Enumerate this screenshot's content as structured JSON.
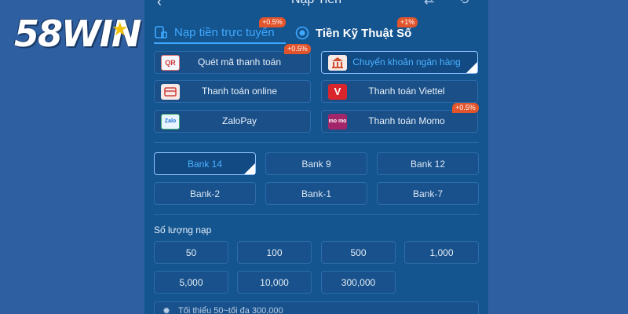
{
  "brand": {
    "logo_text": "58WIN"
  },
  "header": {
    "title": "Nạp Tiền",
    "back_glyph": "‹",
    "icon1": "transfer-icon",
    "icon2": "history-icon"
  },
  "tabs": [
    {
      "label": "Nạp tiền trực tuyến",
      "badge": "+0.5%",
      "active": true
    },
    {
      "label": "Tiền Kỹ Thuật Số",
      "badge": "+1%",
      "active": false
    }
  ],
  "methods": [
    {
      "label": "Quét mã thanh toán",
      "badge": "+0.5%",
      "icon": "qr-icon",
      "icon_text": "QR"
    },
    {
      "label": "Chuyển khoản ngân hàng",
      "badge": "",
      "icon": "bank-icon",
      "icon_text": "",
      "active": true
    },
    {
      "label": "Thanh toán online",
      "badge": "",
      "icon": "card-icon",
      "icon_text": ""
    },
    {
      "label": "Thanh toán Viettel",
      "badge": "",
      "icon": "viettel-icon",
      "icon_text": "V"
    },
    {
      "label": "ZaloPay",
      "badge": "",
      "icon": "zalopay-icon",
      "icon_text": "Zalo"
    },
    {
      "label": "Thanh toán Momo",
      "badge": "+0.5%",
      "icon": "momo-icon",
      "icon_text": "mo mo"
    }
  ],
  "banks": [
    "Bank 14",
    "Bank 9",
    "Bank 12",
    "Bank-2",
    "Bank-1",
    "Bank-7"
  ],
  "amount_section": {
    "label": "Số lượng nạp",
    "amounts": [
      "50",
      "100",
      "500",
      "1,000",
      "5,000",
      "10,000",
      "300,000"
    ],
    "hint": "Tối thiểu 50~tối đa 300,000"
  },
  "colors": {
    "accent": "#3fa9ff",
    "panel": "#14548f",
    "background": "#2e5fa0",
    "badge": "#e2542b"
  }
}
